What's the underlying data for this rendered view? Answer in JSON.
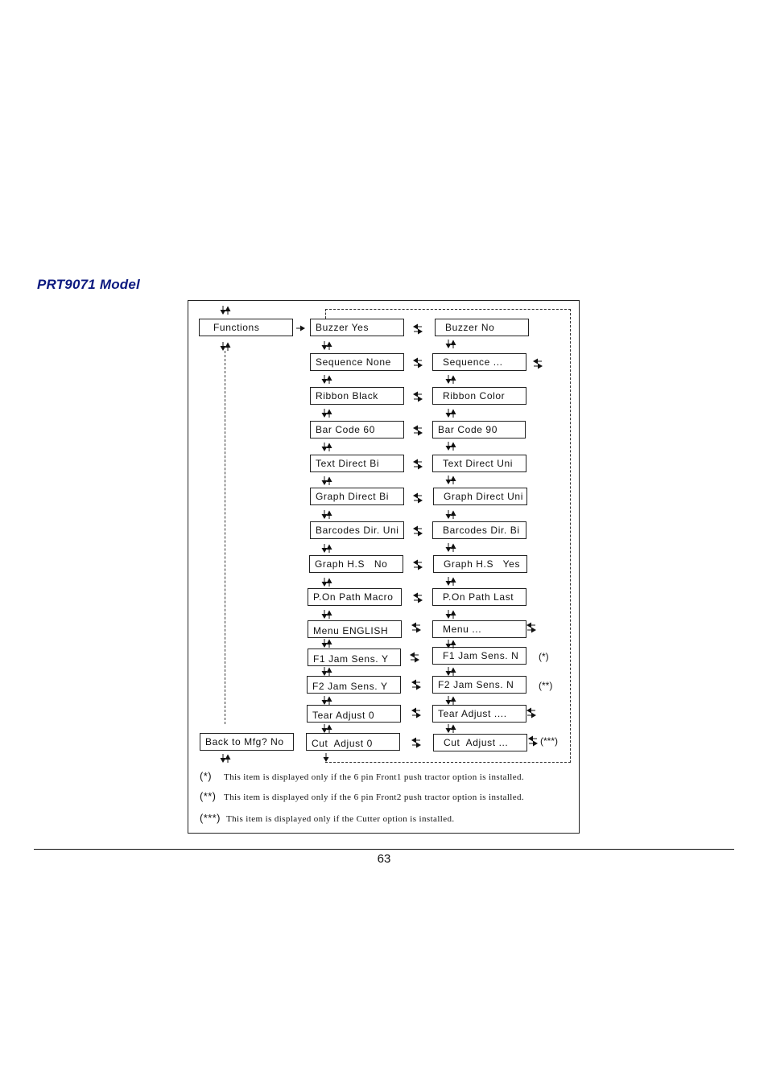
{
  "document": {
    "title": "PRT9071  Model",
    "page_number": "63"
  },
  "diagram": {
    "root": {
      "label": "Functions"
    },
    "back": {
      "label": "Back to Mfg? No"
    },
    "left_column": [
      "Buzzer Yes",
      "Sequence None",
      "Ribbon Black",
      "Bar Code 60",
      "Text Direct Bi",
      "Graph Direct Bi",
      "Barcodes Dir. Uni",
      "Graph H.S   No",
      "P.On Path Macro",
      "Menu ENGLISH",
      "F1 Jam Sens. Y",
      "F2 Jam Sens. Y",
      "Tear Adjust 0",
      "Cut  Adjust 0"
    ],
    "right_column": [
      "Buzzer No",
      "Sequence ...",
      "Ribbon Color",
      "Bar Code 90",
      "Text Direct Uni",
      "Graph Direct Uni",
      "Barcodes Dir. Bi",
      "Graph H.S   Yes",
      "P.On Path Last",
      "Menu ...",
      "F1 Jam Sens. N",
      "F2 Jam Sens. N",
      "Tear Adjust ....",
      "Cut  Adjust ..."
    ],
    "markers": {
      "f1": "(*)",
      "f2": "(**)",
      "cut": "(***)"
    },
    "icons": {
      "vertical_updown": "up-down-arrow-icon",
      "horizontal_swap": "left-right-arrow-icon",
      "right": "right-arrow-icon",
      "down": "down-arrow-icon"
    }
  },
  "footnotes": [
    {
      "mark": "(*)",
      "text": "This item is displayed only if the 6 pin Front1 push tractor option is installed."
    },
    {
      "mark": "(**)",
      "text": "This item is displayed only if the 6 pin Front2 push tractor option is installed."
    },
    {
      "mark": "(***)",
      "text": "This item is displayed only if the Cutter option is installed."
    }
  ]
}
